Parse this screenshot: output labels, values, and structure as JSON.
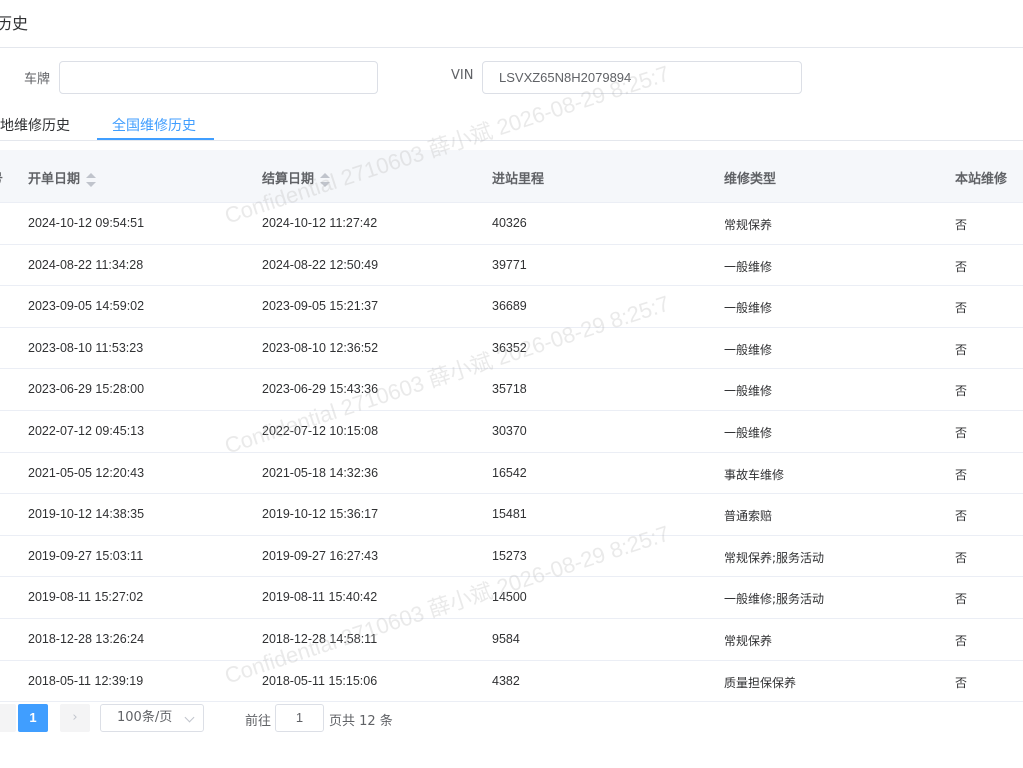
{
  "page": {
    "title": "历史"
  },
  "form": {
    "plate_label": "车牌",
    "plate_value": "",
    "vin_label": "VIN",
    "vin_value": "LSVXZ65N8H2079894"
  },
  "tabs": [
    {
      "label": "地维修历史",
      "active": false
    },
    {
      "label": "全国维修历史",
      "active": true
    }
  ],
  "table": {
    "columns": [
      "号",
      "开单日期",
      "结算日期",
      "进站里程",
      "维修类型",
      "本站维修"
    ],
    "rows": [
      {
        "open": "2024-10-12 09:54:51",
        "settle": "2024-10-12 11:27:42",
        "mileage": "40326",
        "type": "常规保养",
        "local": "否"
      },
      {
        "open": "2024-08-22 11:34:28",
        "settle": "2024-08-22 12:50:49",
        "mileage": "39771",
        "type": "一般维修",
        "local": "否"
      },
      {
        "open": "2023-09-05 14:59:02",
        "settle": "2023-09-05 15:21:37",
        "mileage": "36689",
        "type": "一般维修",
        "local": "否"
      },
      {
        "open": "2023-08-10 11:53:23",
        "settle": "2023-08-10 12:36:52",
        "mileage": "36352",
        "type": "一般维修",
        "local": "否"
      },
      {
        "open": "2023-06-29 15:28:00",
        "settle": "2023-06-29 15:43:36",
        "mileage": "35718",
        "type": "一般维修",
        "local": "否"
      },
      {
        "open": "2022-07-12 09:45:13",
        "settle": "2022-07-12 10:15:08",
        "mileage": "30370",
        "type": "一般维修",
        "local": "否"
      },
      {
        "open": "2021-05-05 12:20:43",
        "settle": "2021-05-18 14:32:36",
        "mileage": "16542",
        "type": "事故车维修",
        "local": "否"
      },
      {
        "open": "2019-10-12 14:38:35",
        "settle": "2019-10-12 15:36:17",
        "mileage": "15481",
        "type": "普通索赔",
        "local": "否"
      },
      {
        "open": "2019-09-27 15:03:11",
        "settle": "2019-09-27 16:27:43",
        "mileage": "15273",
        "type": "常规保养;服务活动",
        "local": "否"
      },
      {
        "open": "2019-08-11 15:27:02",
        "settle": "2019-08-11 15:40:42",
        "mileage": "14500",
        "type": "一般维修;服务活动",
        "local": "否"
      },
      {
        "open": "2018-12-28 13:26:24",
        "settle": "2018-12-28 14:58:11",
        "mileage": "9584",
        "type": "常规保养",
        "local": "否"
      },
      {
        "open": "2018-05-11 12:39:19",
        "settle": "2018-05-11 15:15:06",
        "mileage": "4382",
        "type": "质量担保保养",
        "local": "否"
      }
    ]
  },
  "pagination": {
    "current_page": "1",
    "page_size": "100条/页",
    "goto_label": "前往",
    "goto_value": "1",
    "total_label": "页共 12 条"
  },
  "watermark": {
    "text": "Confidential 2710603 薛小斌 2026-08-29 8:25:7"
  },
  "colors": {
    "accent": "#409eff",
    "header_bg": "#f5f7fa",
    "border": "#ebeef5"
  }
}
